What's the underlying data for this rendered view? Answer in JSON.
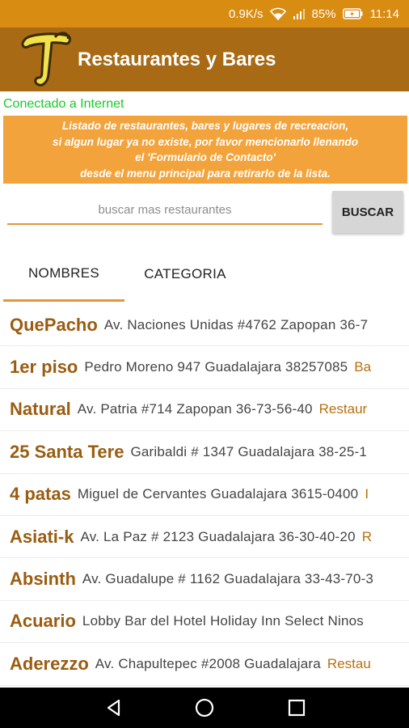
{
  "status_bar": {
    "network_speed": "0.9K/s",
    "battery": "85%",
    "time": "11:14",
    "icons": [
      "wifi-icon",
      "signal-icon",
      "battery-charging-icon"
    ]
  },
  "app_bar": {
    "title": "Restaurantes y Bares",
    "logo": "T-logo",
    "color": "#a86a14"
  },
  "connection_status": "Conectado a Internet",
  "notice": {
    "lines": [
      "Listado de restaurantes, bares y lugares de recreacion,",
      "si algun lugar ya no existe, por favor mencionarlo llenando",
      "el 'Formulario de Contacto'",
      "desde el menu principal para retirarlo de la lista."
    ],
    "color": "#f3a33b"
  },
  "search": {
    "placeholder": "buscar mas restaurantes",
    "value": "",
    "button_label": "BUSCAR"
  },
  "tabs": [
    {
      "label": "NOMBRES",
      "selected": true
    },
    {
      "label": "CATEGORIA",
      "selected": false
    }
  ],
  "items": [
    {
      "name": "QuePacho",
      "address": "Av. Naciones Unidas #4762 Zapopan 36-7",
      "category": ""
    },
    {
      "name": "1er piso",
      "address": "Pedro Moreno 947 Guadalajara 38257085",
      "category": "Ba"
    },
    {
      "name": "Natural",
      "address": "Av. Patria #714 Zapopan 36-73-56-40",
      "category": "Restaur"
    },
    {
      "name": "25 Santa Tere",
      "address": "Garibaldi # 1347 Guadalajara 38-25-1",
      "category": ""
    },
    {
      "name": "4 patas",
      "address": "Miguel de Cervantes Guadalajara 3615-0400",
      "category": "I"
    },
    {
      "name": "Asiati-k",
      "address": "Av. La Paz # 2123 Guadalajara 36-30-40-20",
      "category": "R"
    },
    {
      "name": "Absinth",
      "address": "Av. Guadalupe # 1162 Guadalajara 33-43-70-3",
      "category": ""
    },
    {
      "name": "Acuario",
      "address": "Lobby Bar del Hotel  Holiday Inn Select Ninos",
      "category": ""
    },
    {
      "name": "Aderezzo",
      "address": "Av. Chapultepec #2008 Guadalajara",
      "category": "Restau"
    }
  ],
  "nav_bar": {
    "buttons": [
      "back-icon",
      "home-icon",
      "recents-icon"
    ]
  }
}
